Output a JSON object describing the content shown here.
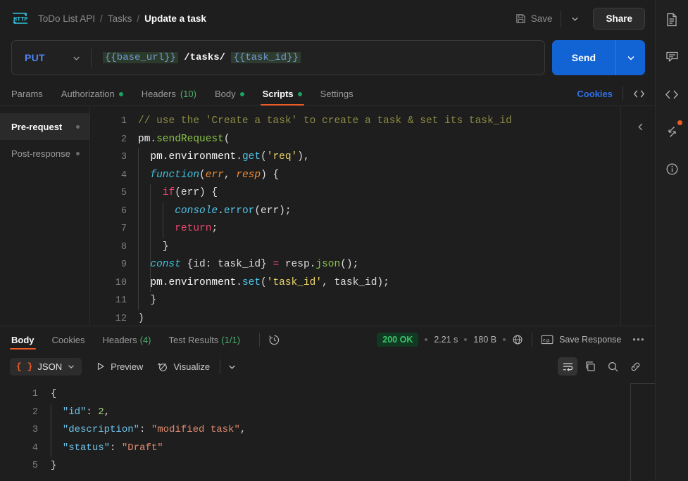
{
  "header": {
    "logo_icon": "http-icon",
    "breadcrumb": [
      "ToDo List API",
      "Tasks",
      "Update a task"
    ],
    "separator": "/",
    "save_label": "Save",
    "save_icon": "floppy-disk-icon",
    "save_caret_icon": "chevron-down-icon",
    "share_label": "Share"
  },
  "url_bar": {
    "method": "PUT",
    "method_caret_icon": "chevron-down-icon",
    "url_parts": [
      {
        "text": "{{base_url}}",
        "type": "variable"
      },
      {
        "text": " /tasks/ ",
        "type": "literal"
      },
      {
        "text": "{{task_id}}",
        "type": "variable"
      }
    ],
    "url_full": "{{base_url}}/tasks/{{task_id}}",
    "send_label": "Send",
    "send_caret_icon": "chevron-down-icon"
  },
  "request_tabs": [
    {
      "label": "Params",
      "badge": "",
      "dot": false,
      "active": false
    },
    {
      "label": "Authorization",
      "badge": "",
      "dot": true,
      "active": false
    },
    {
      "label": "Headers",
      "badge": "(10)",
      "dot": false,
      "active": false
    },
    {
      "label": "Body",
      "badge": "",
      "dot": true,
      "active": false
    },
    {
      "label": "Scripts",
      "badge": "",
      "dot": true,
      "active": true
    },
    {
      "label": "Settings",
      "badge": "",
      "dot": false,
      "active": false
    }
  ],
  "request_tabs_right": {
    "cookies_label": "Cookies",
    "code_icon": "code-brackets-icon"
  },
  "script_sidebar": [
    {
      "label": "Pre-request",
      "active": true,
      "dot": true
    },
    {
      "label": "Post-response",
      "active": false,
      "dot": true
    }
  ],
  "editor": {
    "collapse_icon": "chevron-left-icon",
    "lines": [
      {
        "n": "1",
        "html": "<span class='t-com'>// use the 'Create a task' to create a task &amp; set its task_id</span>"
      },
      {
        "n": "2",
        "html": "<span class='t-var'>pm</span><span class='t-punc'>.</span><span class='t-fn'>sendRequest</span><span class='t-punc'>(</span>"
      },
      {
        "n": "3",
        "html": "<span class='guide'></span>  <span class='t-var'>pm</span><span class='t-punc'>.</span><span class='t-prop'>environment</span><span class='t-punc'>.</span><span class='t-meth'>get</span><span class='t-punc'>(</span><span class='t-str'>'req'</span><span class='t-punc'>),</span>"
      },
      {
        "n": "4",
        "html": "<span class='guide'></span>  <span class='t-kw2'>function</span><span class='t-punc'>(</span><span class='t-par'>err</span><span class='t-punc'>, </span><span class='t-par'>resp</span><span class='t-punc'>) {</span>"
      },
      {
        "n": "5",
        "html": "<span class='guide'></span>  <span class='guide'></span>  <span class='t-kw'>if</span><span class='t-punc'>(err) {</span>"
      },
      {
        "n": "6",
        "html": "<span class='guide'></span>  <span class='guide'></span>  <span class='guide'></span>  <span class='t-obj'>console</span><span class='t-punc'>.</span><span class='t-meth'>error</span><span class='t-punc'>(err);</span>"
      },
      {
        "n": "7",
        "html": "<span class='guide'></span>  <span class='guide'></span>  <span class='guide'></span>  <span class='t-kw'>return</span><span class='t-punc'>;</span>"
      },
      {
        "n": "8",
        "html": "<span class='guide'></span>  <span class='guide'></span>  <span class='t-punc'>}</span>"
      },
      {
        "n": "9",
        "html": "<span class='guide'></span>  <span class='guide'></span><span class='t-kw2'>const</span> <span class='t-punc'>{id: task_id} </span><span class='t-op'>=</span><span class='t-punc'> resp.</span><span class='t-fn'>json</span><span class='t-punc'>();</span>"
      },
      {
        "n": "10",
        "html": "<span class='guide'></span>  <span class='guide'></span><span class='t-var'>pm</span><span class='t-punc'>.</span><span class='t-prop'>environment</span><span class='t-punc'>.</span><span class='t-meth'>set</span><span class='t-punc'>(</span><span class='t-str'>'task_id'</span><span class='t-punc'>, task_id);</span>"
      },
      {
        "n": "11",
        "html": "<span class='guide'></span>  <span class='t-punc'>}</span>"
      },
      {
        "n": "12",
        "html": "<span class='t-punc'>)</span>"
      }
    ],
    "code_text": "// use the 'Create a task' to create a task & set its task_id\npm.sendRequest(\n  pm.environment.get('req'),\n  function(err, resp) {\n    if(err) {\n      console.error(err);\n      return;\n    }\n    const {id: task_id} = resp.json();\n    pm.environment.set('task_id', task_id);\n  }\n)"
  },
  "response": {
    "tabs": [
      {
        "label": "Body",
        "badge": "",
        "active": true
      },
      {
        "label": "Cookies",
        "badge": "",
        "active": false
      },
      {
        "label": "Headers",
        "badge": "(4)",
        "active": false
      },
      {
        "label": "Test Results",
        "badge": "(1/1)",
        "active": false
      }
    ],
    "history_icon": "clock-history-icon",
    "status": "200 OK",
    "time": "2.21 s",
    "size": "180 B",
    "globe_icon": "globe-icon",
    "save_response_icon": "example-icon",
    "save_response_label": "Save Response",
    "more_icon": "ellipsis-icon",
    "toolbar": {
      "format_label": "JSON",
      "format_braces": "{ }",
      "format_caret_icon": "chevron-down-icon",
      "preview_label": "Preview",
      "preview_icon": "play-icon",
      "visualize_label": "Visualize",
      "visualize_icon": "magic-wand-icon",
      "extra_caret_icon": "chevron-down-icon",
      "wrap_icon": "wrap-text-icon",
      "copy_icon": "copy-icon",
      "search_icon": "search-icon",
      "link_icon": "link-icon"
    },
    "body_lines": [
      {
        "n": "1",
        "html": "<span class='j-punc'>{</span>"
      },
      {
        "n": "2",
        "html": "<span class='guide'></span>  <span class='j-key'>\"id\"</span><span class='j-punc'>: </span><span class='j-num'>2</span><span class='j-punc'>,</span>"
      },
      {
        "n": "3",
        "html": "<span class='guide'></span>  <span class='j-key'>\"description\"</span><span class='j-punc'>: </span><span class='j-str'>\"modified task\"</span><span class='j-punc'>,</span>"
      },
      {
        "n": "4",
        "html": "<span class='guide'></span>  <span class='j-key'>\"status\"</span><span class='j-punc'>: </span><span class='j-str'>\"Draft\"</span>"
      },
      {
        "n": "5",
        "html": "<span class='j-punc'>}</span>"
      }
    ],
    "body_text": "{\n  \"id\": 2,\n  \"description\": \"modified task\",\n  \"status\": \"Draft\"\n}"
  },
  "right_rail": [
    {
      "icon": "document-icon",
      "badge": false
    },
    {
      "icon": "comment-icon",
      "badge": false
    },
    {
      "icon": "code-brackets-icon",
      "badge": false
    },
    {
      "icon": "resize-arrows-icon",
      "badge": true
    },
    {
      "icon": "info-circle-icon",
      "badge": false
    }
  ],
  "colors": {
    "accent_orange": "#ef5b25",
    "send_blue": "#1263d4",
    "method_blue": "#4f86f7",
    "status_green": "#3ec46d",
    "link_blue": "#2f6fe4",
    "background": "#1e1e1e"
  }
}
